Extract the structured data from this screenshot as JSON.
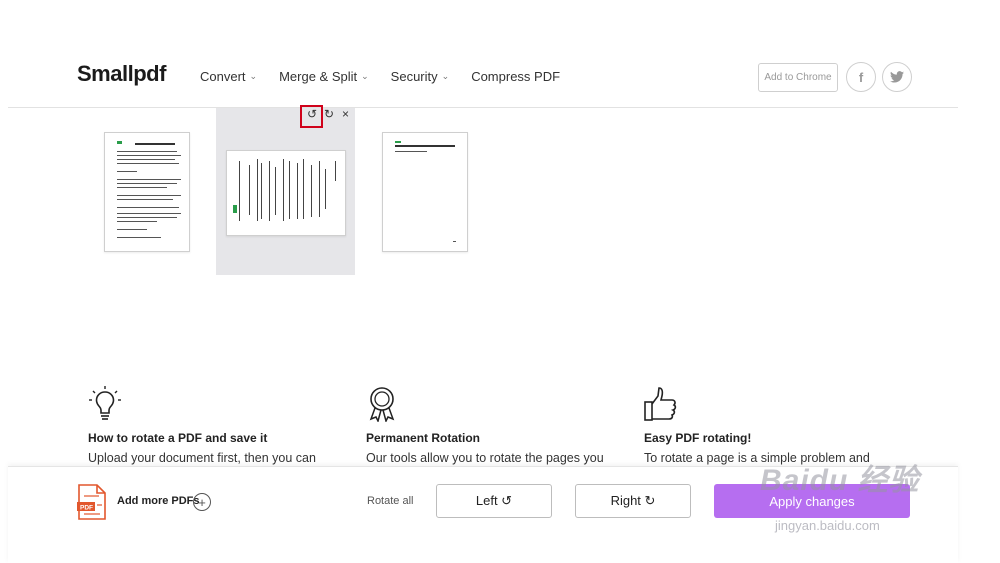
{
  "header": {
    "logo": "Smallpdf",
    "nav": [
      {
        "label": "Convert"
      },
      {
        "label": "Merge & Split"
      },
      {
        "label": "Security"
      },
      {
        "label": "Compress PDF"
      }
    ],
    "add_chrome": "Add to Chrome",
    "social": {
      "facebook": "f",
      "twitter": "twitter-icon"
    }
  },
  "page_controls": {
    "rotate_left": "↺",
    "rotate_right": "↻",
    "remove": "×"
  },
  "features": [
    {
      "icon": "lightbulb-icon",
      "title": "How to rotate a PDF and save it",
      "text": "Upload your document first, then you can"
    },
    {
      "icon": "award-ribbon-icon",
      "title": "Permanent Rotation",
      "text": "Our tools allow you to rotate the pages you"
    },
    {
      "icon": "thumbs-up-icon",
      "title": "Easy PDF rotating!",
      "text": "To rotate a page is a simple problem and"
    }
  ],
  "bottom_bar": {
    "add_more": "Add more PDFs",
    "rotate_all": "Rotate all",
    "left_button": "Left ↺",
    "right_button": "Right ↻",
    "apply_button": "Apply changes"
  },
  "watermark": {
    "main": "Baidu 经验",
    "sub": "jingyan.baidu.com"
  },
  "colors": {
    "accent": "#b66ef0",
    "highlight": "#d0021b"
  }
}
